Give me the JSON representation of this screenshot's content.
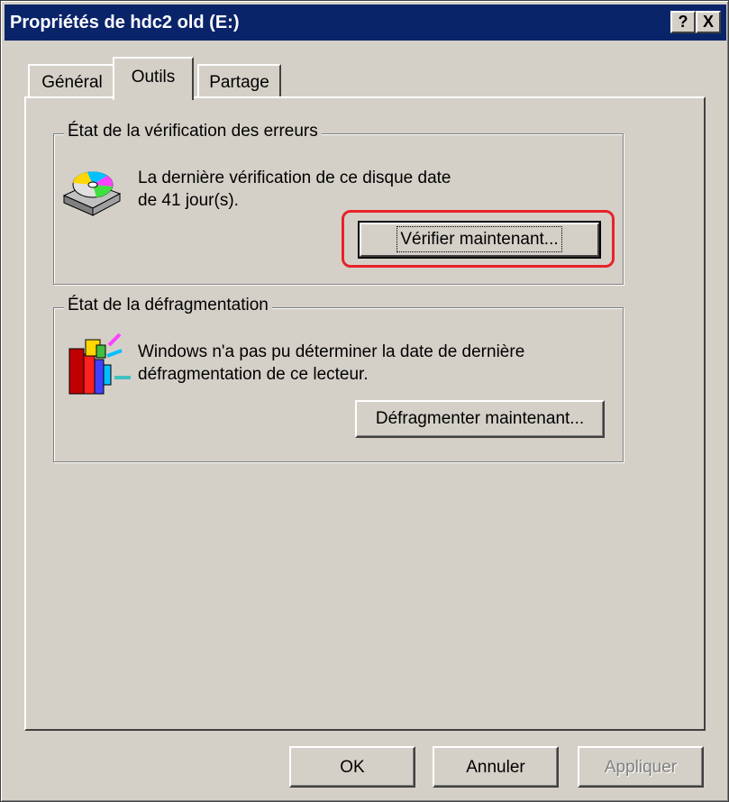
{
  "window": {
    "title": "Propriétés de hdc2 old (E:)",
    "help_label": "?",
    "close_label": "X",
    "colors": {
      "titlebar": "#0a246a",
      "face": "#d4d0c8",
      "highlight": "#e8232a"
    }
  },
  "tabs": [
    {
      "label": "Général",
      "selected": false
    },
    {
      "label": "Outils",
      "selected": true
    },
    {
      "label": "Partage",
      "selected": false
    }
  ],
  "error_check": {
    "legend": "État de la vérification des erreurs",
    "line1": "La dernière vérification de ce disque date",
    "line2": "de 41 jour(s).",
    "button_label": "Vérifier maintenant...",
    "icon": "disk-check-icon"
  },
  "defrag": {
    "legend": "État de la défragmentation",
    "line1": "Windows n'a pas pu déterminer la date de dernière",
    "line2": "défragmentation de ce lecteur.",
    "button_label": "Défragmenter maintenant...",
    "icon": "defrag-icon"
  },
  "footer": {
    "ok_label": "OK",
    "cancel_label": "Annuler",
    "apply_label": "Appliquer"
  }
}
